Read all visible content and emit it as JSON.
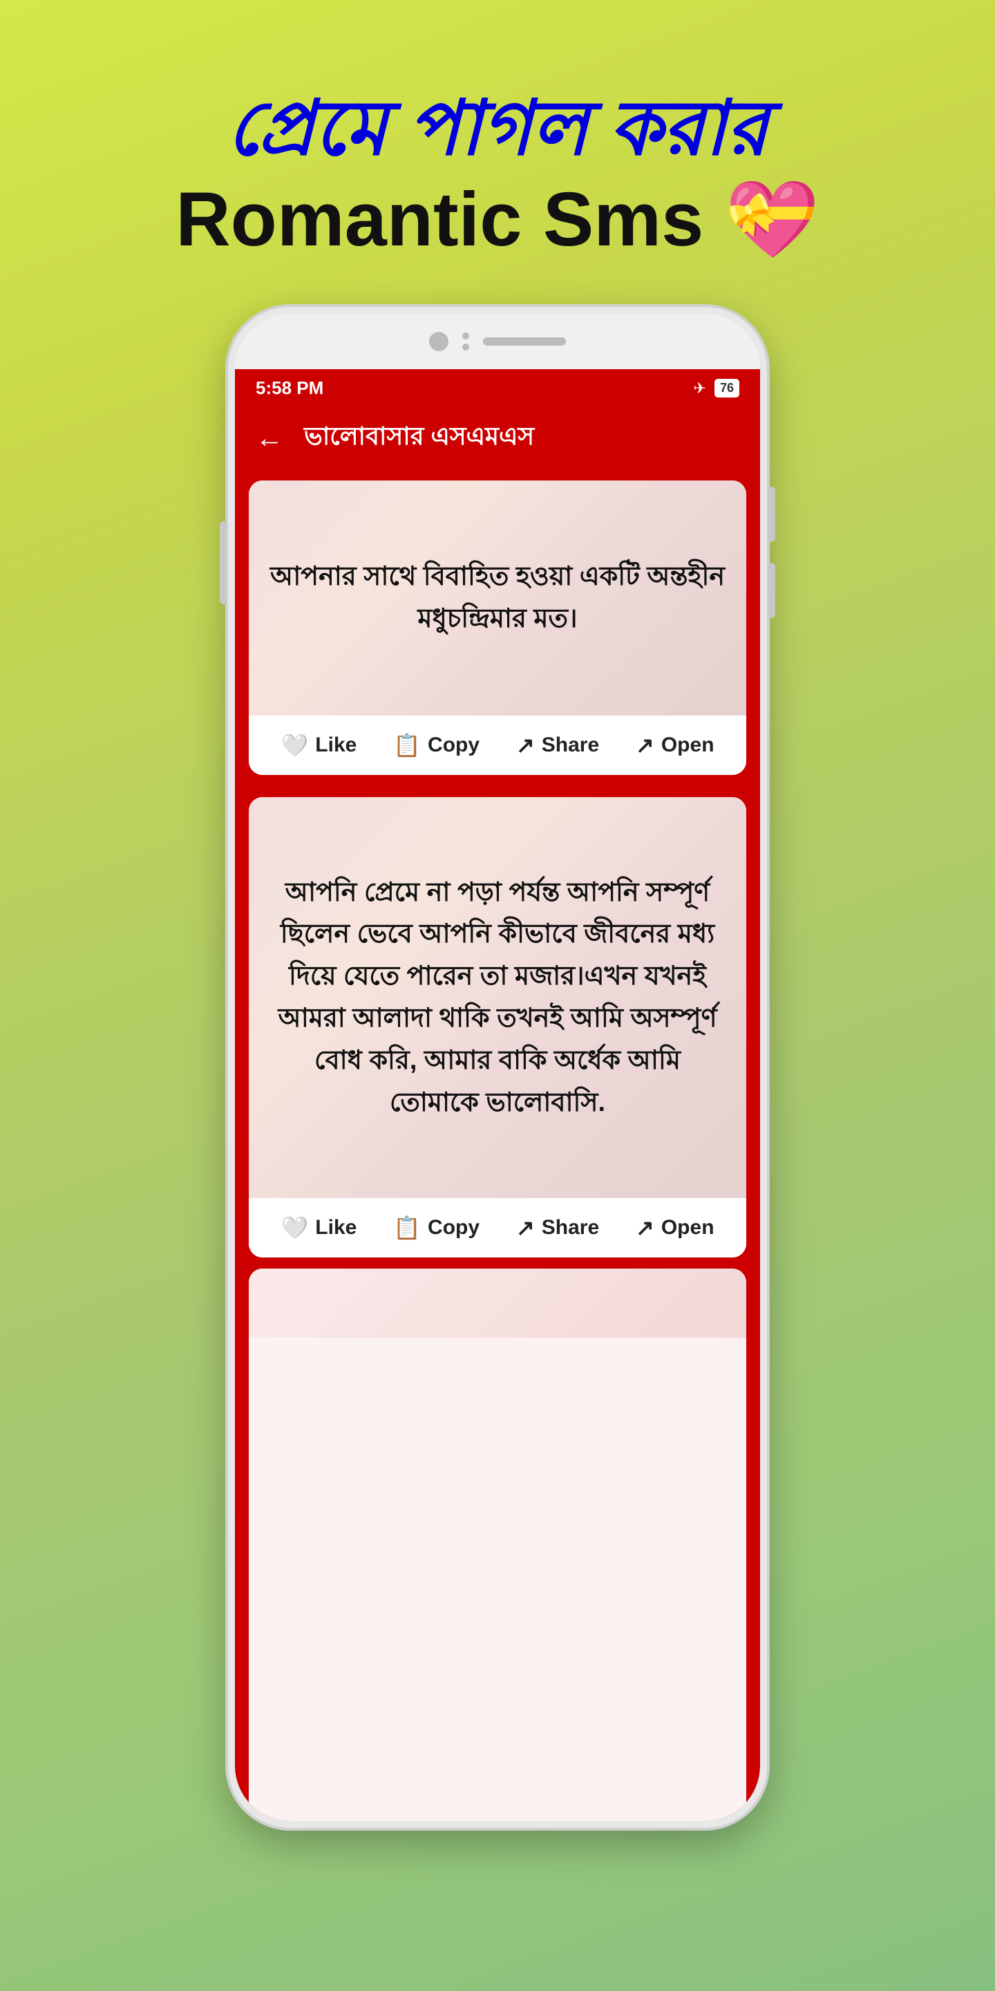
{
  "page": {
    "background": "linear-gradient green-yellow",
    "header": {
      "bengali_title": "প্রেমে পাগল করার",
      "english_title": "Romantic Sms 💝"
    },
    "phone": {
      "status_bar": {
        "time": "5:58 PM",
        "airplane_mode": "✈",
        "battery": "76"
      },
      "app_bar": {
        "title": "ভালোবাসার এসএমএস",
        "back_label": "←"
      },
      "cards": [
        {
          "id": "card-1",
          "text": "আপনার সাথে বিবাহিত হওয়া একটি অন্তহীন মধুচন্দ্রিমার মত।",
          "actions": {
            "like": "Like",
            "copy": "Copy",
            "share": "Share",
            "open": "Open"
          }
        },
        {
          "id": "card-2",
          "text": "আপনি প্রেমে না পড়া পর্যন্ত আপনি সম্পূর্ণ ছিলেন ভেবে আপনি কীভাবে জীবনের মধ্য দিয়ে যেতে পারেন তা মজার।এখন যখনই আমরা আলাদা থাকি তখনই আমি অসম্পূর্ণ বোধ করি, আমার বাকি অর্ধেক আমি তোমাকে ভালোবাসি.",
          "actions": {
            "like": "Like",
            "copy": "Copy",
            "share": "Share",
            "open": "Open"
          }
        }
      ]
    }
  }
}
